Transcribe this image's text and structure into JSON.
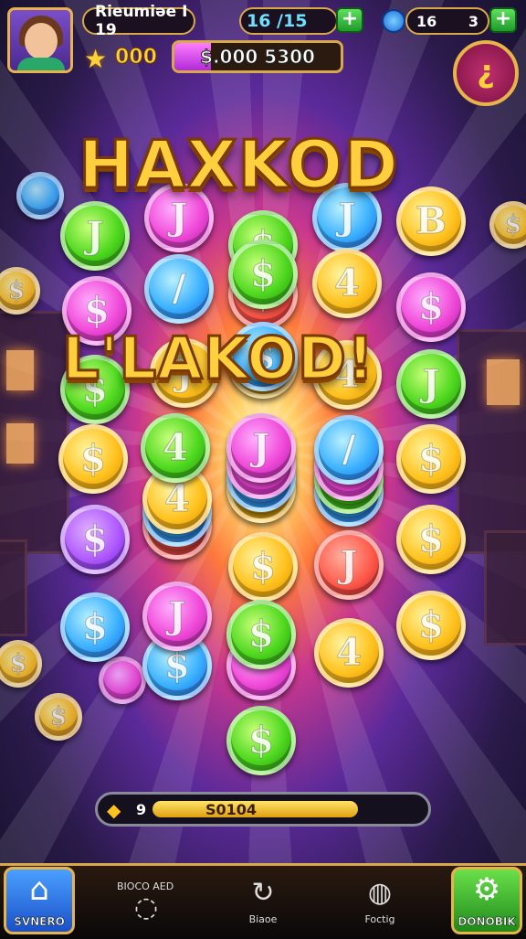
{
  "player": {
    "name": "Rieumiәe I 19"
  },
  "resources": {
    "energy": "16 /15",
    "gems_label": "16",
    "gems_value": "3",
    "stars": "000",
    "xp_text": "$.000 5300",
    "xp_fill": 0.22
  },
  "menu_button": {
    "glyph": "¿"
  },
  "banner": {
    "line1": "HAXKOD",
    "line2": "L'LAKOD!"
  },
  "board": {
    "coin_symbols": [
      "J",
      "$",
      "4",
      "B",
      "/"
    ]
  },
  "progress": {
    "icon": "◆",
    "count": "9",
    "value_text": "S0104",
    "fill": 0.75
  },
  "nav": {
    "home_label": "SVNERO",
    "top_label": "BIOCO AED",
    "item2_label": "Biaoe",
    "item3_label": "Foctig",
    "settings_label": "DONOBIK"
  },
  "colors": {
    "gold": "#ffc21e",
    "green": "#4ed81e",
    "pink": "#f048d8",
    "blue": "#3ab0ff",
    "red": "#ff5a4a"
  }
}
